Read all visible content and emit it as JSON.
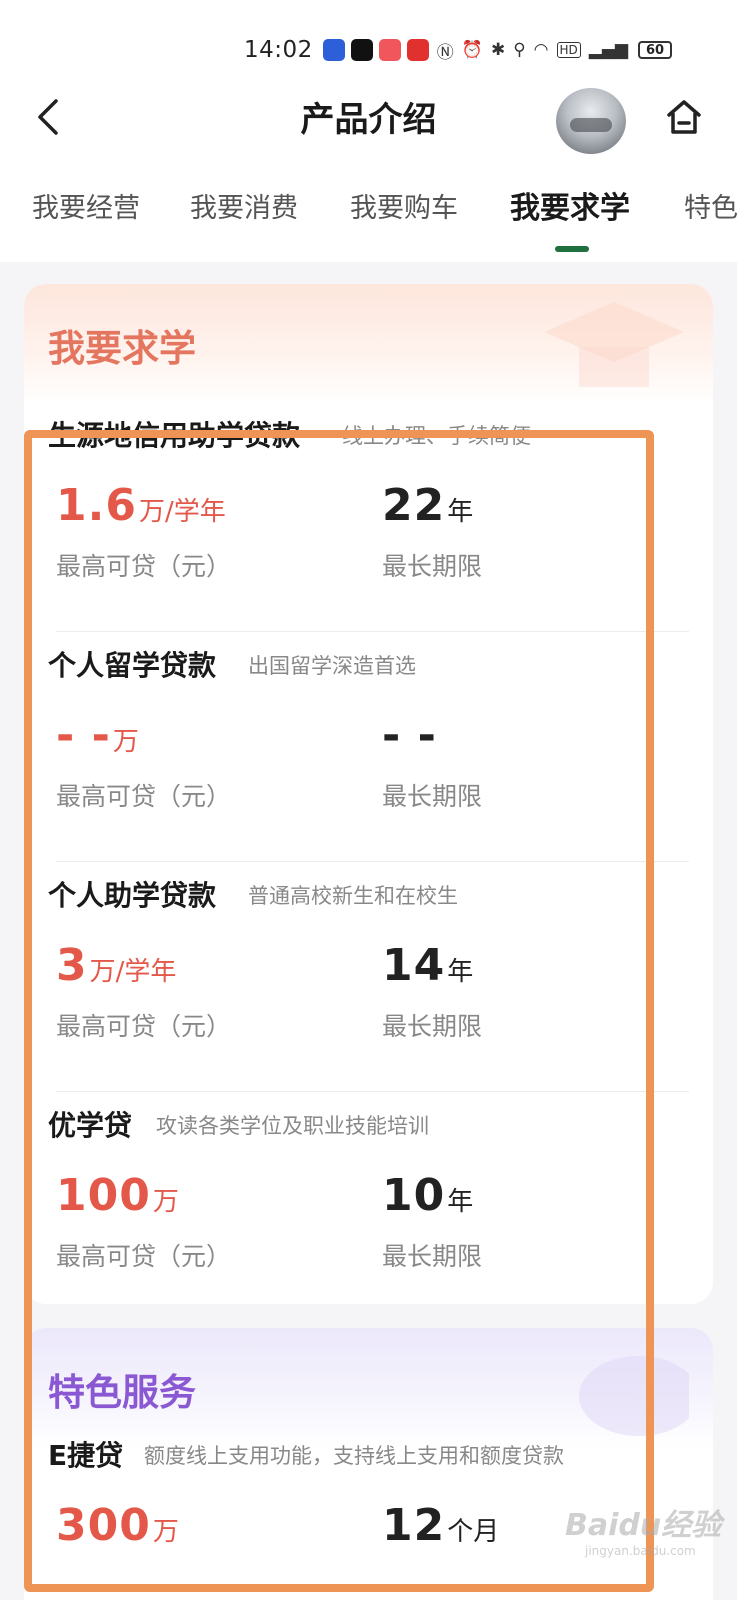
{
  "status_bar": {
    "time": "14:02",
    "battery": "60",
    "app_icons": [
      {
        "name": "app-robot-icon",
        "color": "#2d5fd8"
      },
      {
        "name": "app-tiktok-icon",
        "color": "#111111"
      },
      {
        "name": "app-swan-icon",
        "color": "#f0565c"
      },
      {
        "name": "app-news-icon",
        "color": "#e0312f"
      }
    ],
    "system_icons": [
      "nfc-icon",
      "alarm-icon",
      "bluetooth-icon",
      "location-icon",
      "wifi-icon",
      "hd-icon",
      "signal-icon"
    ]
  },
  "header": {
    "title": "产品介绍"
  },
  "tabs": [
    {
      "label": "我要经营",
      "active": false
    },
    {
      "label": "我要消费",
      "active": false
    },
    {
      "label": "我要购车",
      "active": false
    },
    {
      "label": "我要求学",
      "active": true
    },
    {
      "label": "特色",
      "active": false
    }
  ],
  "education": {
    "section_title": "我要求学",
    "products": [
      {
        "name": "生源地信用助学贷款",
        "desc": "线上办理、手续简便",
        "amount": "1.6",
        "amount_unit": "万/学年",
        "amount_label": "最高可贷（元）",
        "term": "22",
        "term_unit": "年",
        "term_label": "最长期限"
      },
      {
        "name": "个人留学贷款",
        "desc": "出国留学深造首选",
        "amount": "- -",
        "amount_unit": "万",
        "amount_label": "最高可贷（元）",
        "term": "- -",
        "term_unit": "",
        "term_label": "最长期限"
      },
      {
        "name": "个人助学贷款",
        "desc": "普通高校新生和在校生",
        "amount": "3",
        "amount_unit": "万/学年",
        "amount_label": "最高可贷（元）",
        "term": "14",
        "term_unit": "年",
        "term_label": "最长期限"
      },
      {
        "name": "优学贷",
        "desc": "攻读各类学位及职业技能培训",
        "amount": "100",
        "amount_unit": "万",
        "amount_label": "最高可贷（元）",
        "term": "10",
        "term_unit": "年",
        "term_label": "最长期限"
      }
    ]
  },
  "special": {
    "section_title": "特色服务",
    "products": [
      {
        "name": "E捷贷",
        "desc": "额度线上支用功能，支持线上支用和额度贷款",
        "amount": "300",
        "amount_unit": "万",
        "term": "12",
        "term_unit": "个月"
      }
    ]
  },
  "watermark": {
    "brand": "Baidu经验",
    "url": "jingyan.baidu.com"
  },
  "colors": {
    "accent_red": "#e4584a",
    "edu_title": "#e4755f",
    "special_title": "#8b58d3",
    "tab_indicator": "#1f6f3f",
    "highlight_border": "#ee9455"
  }
}
